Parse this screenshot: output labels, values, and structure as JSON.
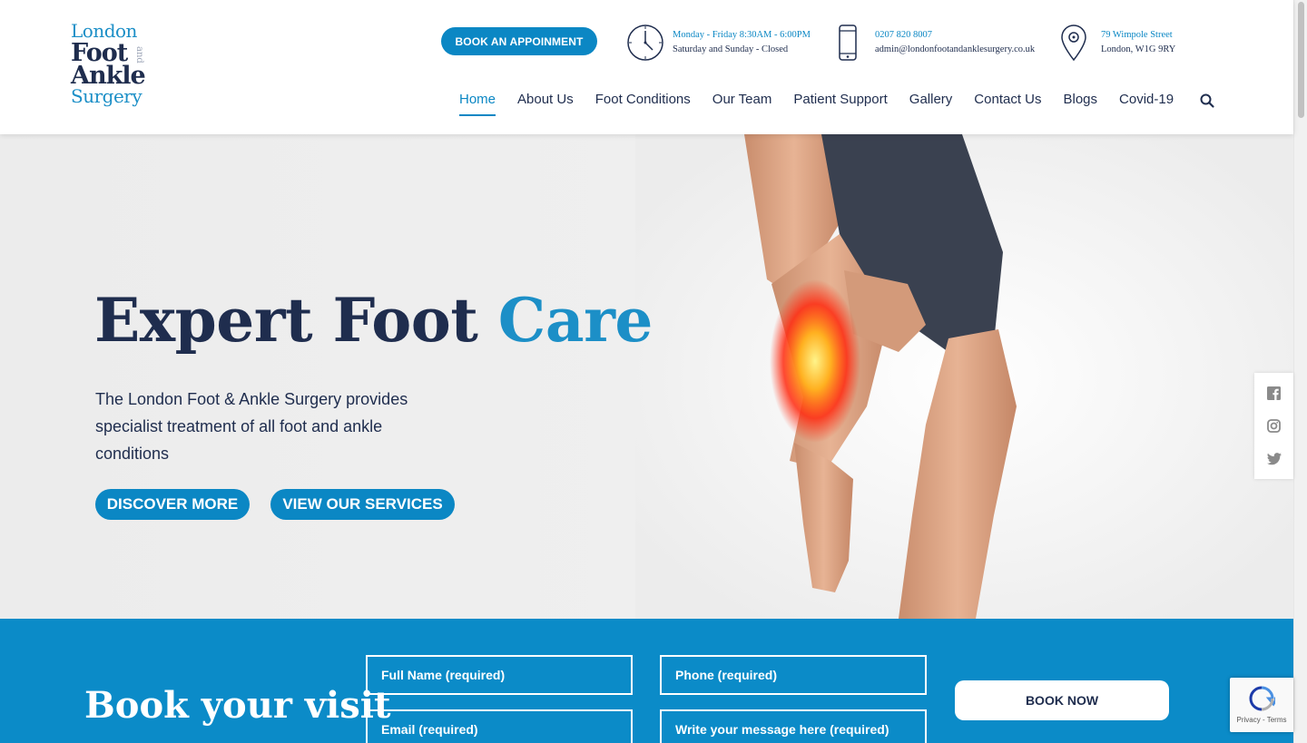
{
  "logo": {
    "line1": "London",
    "line2": "Foot",
    "line3": "Ankle",
    "line4": "Surgery",
    "and": "and"
  },
  "header": {
    "appointment_label": "BOOK AN APPOINMENT",
    "hours": {
      "line1": "Monday - Friday 8:30AM - 6:00PM",
      "line2": "Saturday and Sunday - Closed",
      "icon": "clock-icon"
    },
    "contact": {
      "phone": "0207 820 8007",
      "email": "admin@londonfootandanklesurgery.co.uk",
      "icon": "mobile-phone-icon"
    },
    "address": {
      "line1": "79 Wimpole Street",
      "line2": "London, W1G 9RY",
      "icon": "location-pin-icon"
    }
  },
  "nav": {
    "items": [
      {
        "label": "Home",
        "active": true
      },
      {
        "label": "About Us"
      },
      {
        "label": "Foot Conditions"
      },
      {
        "label": "Our Team"
      },
      {
        "label": "Patient Support"
      },
      {
        "label": "Gallery"
      },
      {
        "label": "Contact Us"
      },
      {
        "label": "Blogs"
      },
      {
        "label": "Covid-19"
      }
    ],
    "search_icon": "search-icon"
  },
  "hero": {
    "title_main": "Expert Foot",
    "title_accent": "Care",
    "subtitle": "The London Foot & Ankle Surgery provides specialist treatment of all foot and ankle conditions",
    "discover_label": "DISCOVER MORE",
    "services_label": "VIEW OUR SERVICES"
  },
  "social": [
    "facebook-icon",
    "instagram-icon",
    "twitter-icon"
  ],
  "booking": {
    "title": "Book your visit",
    "name_placeholder": "Full Name  (required)",
    "phone_placeholder": "Phone (required)",
    "email_placeholder": "Email (required)",
    "message_placeholder": "Write your message here (required)",
    "submit_label": "BOOK NOW"
  },
  "recaptcha": {
    "links": "Privacy - Terms"
  },
  "colors": {
    "brand_blue": "#0b87c4",
    "navy": "#1f2d4e",
    "band_blue": "#0b8bc8"
  }
}
